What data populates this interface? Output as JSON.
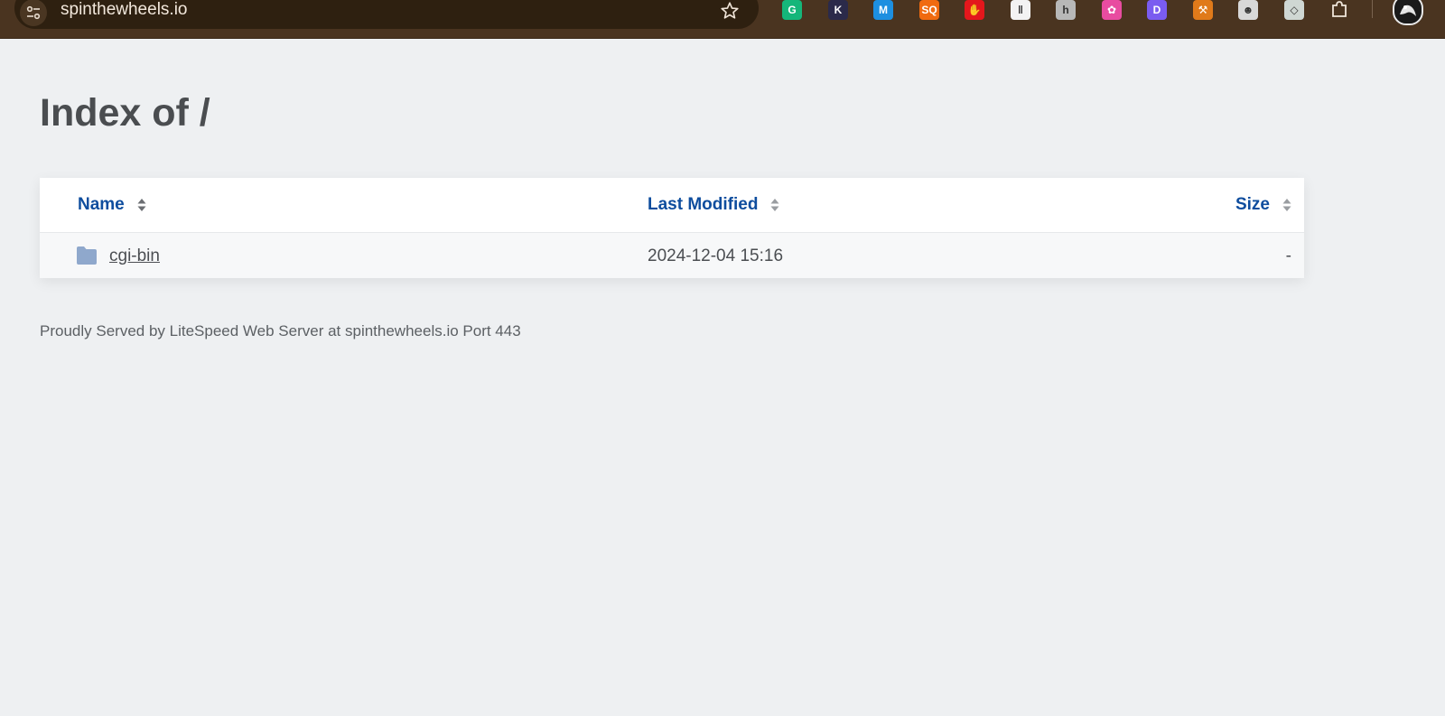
{
  "browser": {
    "url": "spinthewheels.io",
    "extensions": [
      {
        "icon": "grammarly-icon",
        "glyph": "G",
        "color": "#15b67a"
      },
      {
        "icon": "k-extension-icon",
        "glyph": "K",
        "color": "#2b2a4a"
      },
      {
        "icon": "m-extension-icon",
        "glyph": "M",
        "color": "#1d8fe0"
      },
      {
        "icon": "sq-extension-icon",
        "glyph": "SQ",
        "color": "#f06a10"
      },
      {
        "icon": "hand-stop-icon",
        "glyph": "✋",
        "color": "#e3171c"
      },
      {
        "icon": "bars-extension-icon",
        "glyph": "‖",
        "color": "#f3f3f3"
      },
      {
        "icon": "h-extension-icon",
        "glyph": "h",
        "color": "#b8b8b8"
      },
      {
        "icon": "color-wheel-icon",
        "glyph": "✿",
        "color": "#e84ca0"
      },
      {
        "icon": "d-extension-icon",
        "glyph": "D",
        "color": "#7a5cf0"
      },
      {
        "icon": "pickaxe-icon",
        "glyph": "⚒",
        "color": "#e07a1a"
      },
      {
        "icon": "robot-extension-icon",
        "glyph": "☻",
        "color": "#d8d8d8"
      },
      {
        "icon": "diamond-extension-icon",
        "glyph": "◇",
        "color": "#cfd7d3"
      },
      {
        "icon": "puzzle-icon",
        "glyph": "",
        "color": "#ffffff"
      }
    ]
  },
  "page": {
    "title": "Index of /",
    "columns": {
      "name": "Name",
      "last_modified": "Last Modified",
      "size": "Size"
    },
    "rows": [
      {
        "name": "cgi-bin",
        "last_modified": "2024-12-04 15:16",
        "size": "-"
      }
    ],
    "footer": "Proudly Served by LiteSpeed Web Server at spinthewheels.io Port 443"
  },
  "colors": {
    "link": "#0e4d9e",
    "background": "#eef0f2",
    "folder": "#8fa8cc"
  }
}
